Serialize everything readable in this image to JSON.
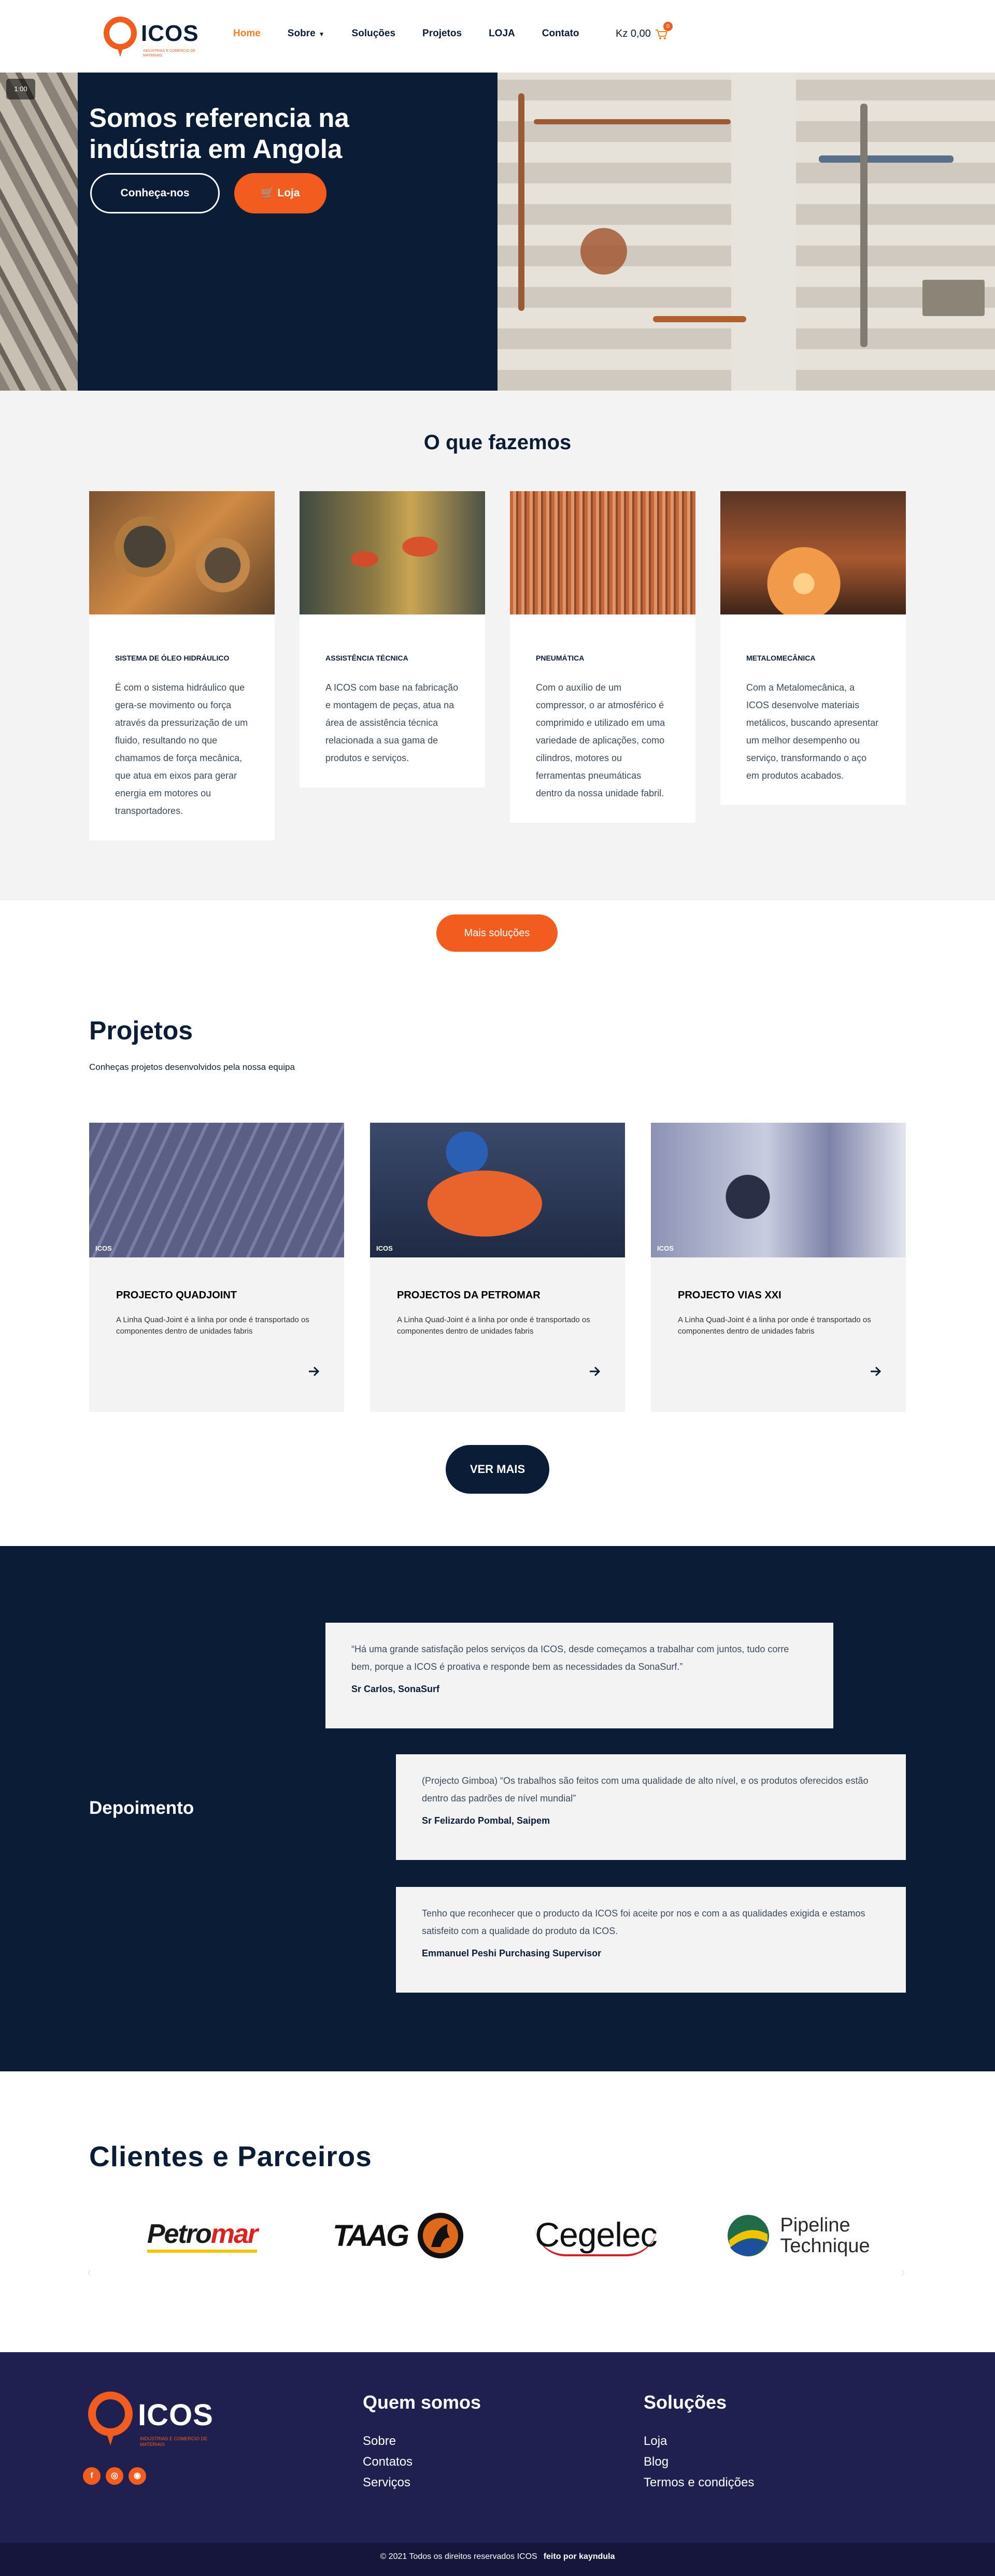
{
  "header": {
    "logo_text": "ICOS",
    "logo_tagline": "Industrias e Comercio de Materiais",
    "nav": [
      {
        "label": "Home",
        "active": true
      },
      {
        "label": "Sobre",
        "active": false,
        "dropdown": true
      },
      {
        "label": "Soluções",
        "active": false
      },
      {
        "label": "Projetos",
        "active": false
      },
      {
        "label": "LOJA",
        "active": false
      },
      {
        "label": "Contato",
        "active": false
      }
    ],
    "cart_total": "Kz 0,00",
    "cart_count": "0"
  },
  "hero": {
    "timestamp": "1:00",
    "title": "Somos referencia na indústria em Angola",
    "cta_primary": "Conheça-nos",
    "cta_secondary": "Loja"
  },
  "services": {
    "title": "O que fazemos",
    "items": [
      {
        "title": "SISTEMA DE ÓLEO HIDRÁULICO",
        "text": " É com o sistema hidráulico que gera-se movimento ou força através da pressurização de um fluido, resultando no que chamamos de força mecânica, que atua em eixos para gerar energia em motores ou transportadores.",
        "image": "gears-photo"
      },
      {
        "title": "ASSISTÊNCIA TÉCNICA",
        "text": " A ICOS com base na fabricação e montagem de peças, atua na área de assistência técnica relacionada a sua gama de produtos e serviços.",
        "image": "technician-photo"
      },
      {
        "title": "PNEUMÁTICA",
        "text": "Com o auxílio de um compressor, o ar atmosférico é comprimido e utilizado em uma variedade de aplicações, como cilindros, motores ou ferramentas pneumáticas dentro da nossa unidade fabril.",
        "image": "pneumatic-photo"
      },
      {
        "title": "METALOMECÂNICA",
        "text": "Com a Metalomecânica, a ICOS desenvolve materiais metálicos, buscando apresentar um melhor desempenho ou serviço, transformando o aço em produtos acabados.",
        "image": "metal-cutting-photo"
      }
    ],
    "more_button": "Mais soluções"
  },
  "projects": {
    "title": "Projetos",
    "subtitle": "Conheças projetos desenvolvidos pela nossa equipa",
    "image_watermark": "ICOS",
    "items": [
      {
        "title": "PROJECTO QUADJOINT",
        "text": "A Linha Quad-Joint é a linha por onde é transportado os componentes dentro de unidades fabris"
      },
      {
        "title": "PROJECTOS DA PETROMAR",
        "text": "A Linha Quad-Joint é a linha por onde é transportado os componentes dentro de unidades fabris"
      },
      {
        "title": "PROJECTO VIAS XXI",
        "text": "A Linha Quad-Joint é a linha por onde é transportado os componentes dentro de unidades fabris"
      }
    ],
    "more_button": "VER MAIS"
  },
  "testimonials": {
    "label": "Depoimento",
    "items": [
      {
        "quote": "“Há uma grande satisfação pelos serviços da ICOS, desde começamos a trabalhar com juntos, tudo corre bem, porque a ICOS é proativa e responde bem as necessidades da SonaSurf.”",
        "author": "Sr Carlos, SonaSurf"
      },
      {
        "quote": "(Projecto Gimboa) “Os trabalhos são feitos com uma qualidade de alto nível, e os produtos oferecidos estão dentro das padrões de nível mundial”",
        "author": "Sr Felizardo Pombal, Saipem"
      },
      {
        "quote": "Tenho que reconhecer que o producto da ICOS foi aceite por nos e com a as qualidades exigida e estamos satisfeito com a qualidade do produto da ICOS.",
        "author": "Emmanuel Peshi Purchasing Supervisor"
      }
    ]
  },
  "clients": {
    "title": "Clientes e Parceiros",
    "logos": [
      {
        "name": "petromar",
        "text_a": "Petro",
        "text_b": "mar"
      },
      {
        "name": "taag",
        "text": "TAAG"
      },
      {
        "name": "cegelec",
        "text": "Cegelec"
      },
      {
        "name": "pipeline-technique",
        "line1": "Pipeline",
        "line2": "Technique"
      }
    ]
  },
  "footer": {
    "logo_text": "ICOS",
    "logo_tagline": "Industrias e Comercio de Materiais",
    "col1_title": "Quem somos",
    "col1_links": [
      "Sobre",
      "Contatos",
      "Serviços"
    ],
    "col2_title": "Soluções",
    "col2_links": [
      "Loja",
      "Blog",
      "Termos e condições"
    ],
    "copyright": "© 2021 Todos os direitos reservados ICOS",
    "credit": "feito por kayndula",
    "social": [
      "f",
      "◎",
      "◉"
    ]
  },
  "colors": {
    "navy": "#0b1d36",
    "orange": "#f25c1f",
    "footer": "#1f2050",
    "light_gray": "#f3f3f3"
  }
}
